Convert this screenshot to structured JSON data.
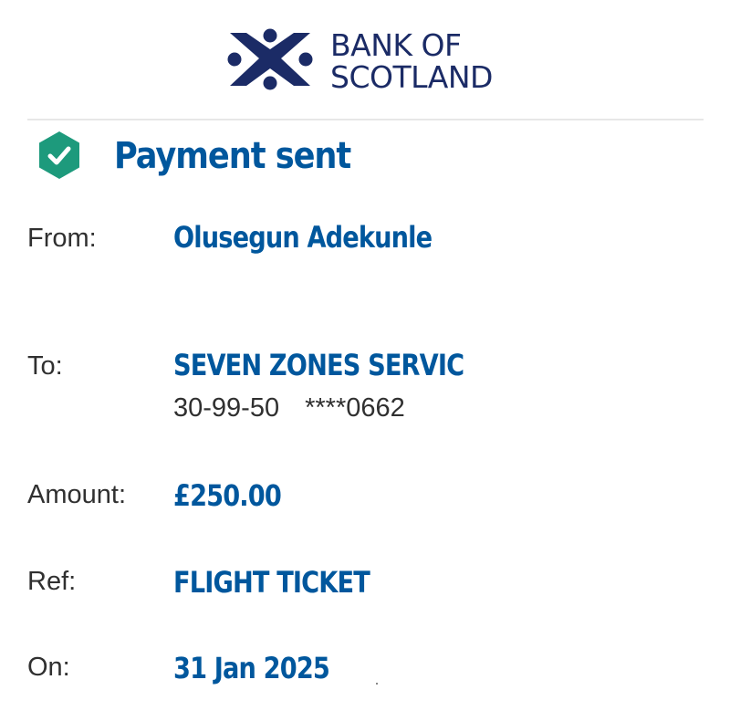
{
  "brand": {
    "line1": "BANK OF",
    "line2": "SCOTLAND",
    "color": "#1b2b66",
    "logo_icon": "saltire-cross-icon"
  },
  "status": {
    "title": "Payment sent",
    "icon": "check-hexagon-icon",
    "icon_color": "#1d9a7c",
    "title_color": "#00579d"
  },
  "details": {
    "from": {
      "label": "From:",
      "value": "Olusegun Adekunle"
    },
    "to": {
      "label": "To:",
      "value": "SEVEN ZONES SERVIC",
      "sort_code": "30-99-50",
      "account": "****0662"
    },
    "amount": {
      "label": "Amount:",
      "value": "£250.00"
    },
    "ref": {
      "label": "Ref:",
      "value": "FLIGHT TICKET"
    },
    "on": {
      "label": "On:",
      "value": "31 Jan 2025"
    }
  }
}
